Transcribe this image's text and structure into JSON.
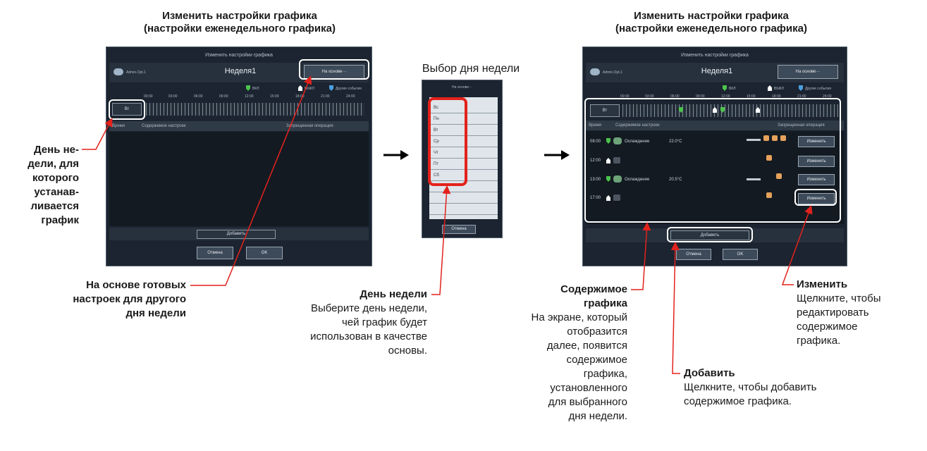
{
  "headings": {
    "left": "Изменить настройки графика\n(настройки еженедельного графика)",
    "middle": "Выбор дня недели",
    "right": "Изменить настройки графика\n(настройки еженедельного графика)"
  },
  "left_screen": {
    "title": "Изменить настройки графика",
    "user": "Admin.Opt.1",
    "week": "Неделя1",
    "based_on": "На основе···",
    "legend_on": "ВКЛ",
    "legend_off": "ВЫКЛ",
    "legend_other": "Другие события",
    "times": [
      "00:00",
      "03:00",
      "06:00",
      "09:00",
      "12:00",
      "15:00",
      "18:00",
      "21:00",
      "24:00"
    ],
    "day": "Вт",
    "col_time": "Время",
    "col_content": "Содержимое настроек",
    "col_prohibit": "Запрещенная операция",
    "add": "Добавить",
    "cancel": "Отмена",
    "ok": "OK"
  },
  "middle_screen": {
    "based_on": "На основе···",
    "days": [
      "Вс",
      "Пн",
      "Вт",
      "Ср",
      "Чт",
      "Пт",
      "Сб"
    ],
    "cancel": "Отмена"
  },
  "right_screen": {
    "title": "Изменить настройки графика",
    "user": "Admin.Opt.1",
    "week": "Неделя1",
    "based_on": "На основе···",
    "legend_on": "ВКЛ",
    "legend_off": "ВЫКЛ",
    "legend_other": "Другие события",
    "times": [
      "00:00",
      "03:00",
      "06:00",
      "09:00",
      "12:00",
      "15:00",
      "18:00",
      "21:00",
      "24:00"
    ],
    "day": "Вт",
    "col_time": "Время",
    "col_content": "Содержимое настроек",
    "col_prohibit": "Запрещенная операция",
    "rows": [
      {
        "time": "08:00",
        "mode": "Охлаждение",
        "temp": "22.0°C",
        "edit": "Изменить"
      },
      {
        "time": "12:00",
        "mode": "",
        "temp": "",
        "edit": "Изменить"
      },
      {
        "time": "13:00",
        "mode": "Охлаждение",
        "temp": "20.5°C",
        "edit": "Изменить"
      },
      {
        "time": "17:00",
        "mode": "",
        "temp": "",
        "edit": "Изменить"
      }
    ],
    "add": "Добавить",
    "cancel": "Отмена",
    "ok": "OK"
  },
  "callouts": {
    "day_of_week_lines": [
      "День не-",
      "дели, для",
      "которого",
      "устанав-",
      "ливается",
      "график"
    ],
    "based_on_lines": [
      "На основе готовых",
      "настроек для другого",
      "дня недели"
    ],
    "day_title": "День недели",
    "day_desc_lines": [
      "Выберите день недели,",
      "чей график будет",
      "использован в качестве",
      "основы."
    ],
    "content_title_lines": [
      "Содержимое",
      "графика"
    ],
    "content_desc_lines": [
      "На экране, который",
      "отобразится",
      "далее, появится",
      "содержимое",
      "графика,",
      "установленного",
      "для выбранного",
      "дня недели."
    ],
    "add_title": "Добавить",
    "add_desc_lines": [
      "Щелкните, чтобы добавить",
      "содержимое графика."
    ],
    "edit_title": "Изменить",
    "edit_desc_lines": [
      "Щелкните, чтобы",
      "редактировать",
      "содержимое",
      "графика."
    ]
  },
  "colors": {
    "red": "#e3221c",
    "panel": "#1b2430",
    "green_marker": "#4cc34c"
  }
}
